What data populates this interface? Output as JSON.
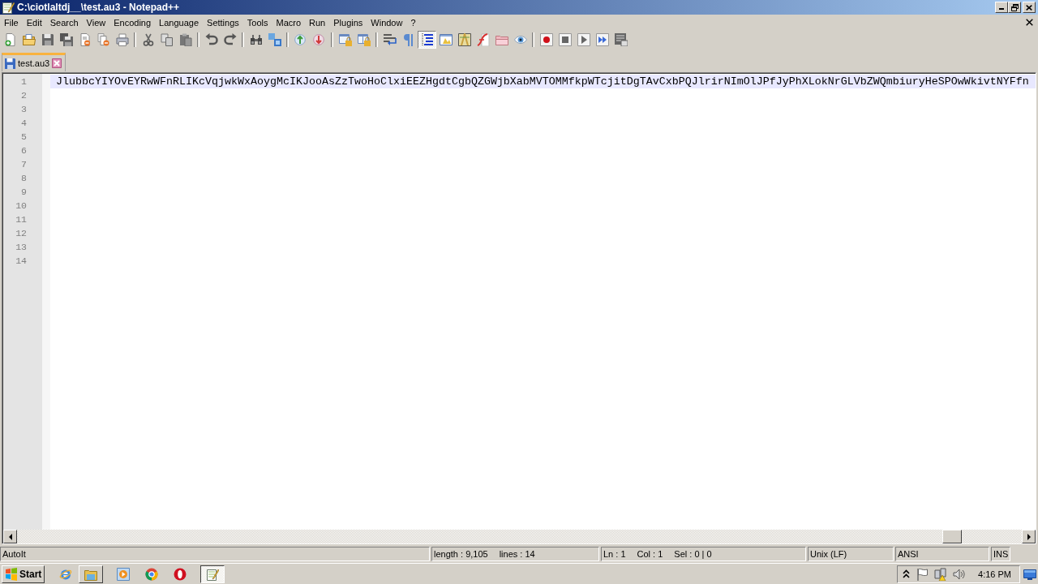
{
  "window": {
    "title": "C:\\ciotlaltdj__\\test.au3 - Notepad++"
  },
  "menu": [
    "File",
    "Edit",
    "Search",
    "View",
    "Encoding",
    "Language",
    "Settings",
    "Tools",
    "Macro",
    "Run",
    "Plugins",
    "Window",
    "?"
  ],
  "toolbar": [
    [
      {
        "kind": "new",
        "pressed": false
      },
      {
        "kind": "open",
        "pressed": false
      },
      {
        "kind": "save",
        "pressed": false
      },
      {
        "kind": "saveall",
        "pressed": false
      },
      {
        "kind": "close",
        "pressed": false
      },
      {
        "kind": "closeall",
        "pressed": false
      },
      {
        "kind": "print",
        "pressed": false
      }
    ],
    [
      {
        "kind": "cut",
        "pressed": false
      },
      {
        "kind": "copy",
        "pressed": false
      },
      {
        "kind": "paste",
        "pressed": false
      }
    ],
    [
      {
        "kind": "undo",
        "pressed": false
      },
      {
        "kind": "redo",
        "pressed": false
      }
    ],
    [
      {
        "kind": "find",
        "pressed": false
      },
      {
        "kind": "replace",
        "pressed": false
      }
    ],
    [
      {
        "kind": "zoomin",
        "pressed": false
      },
      {
        "kind": "zoomout",
        "pressed": false
      }
    ],
    [
      {
        "kind": "syncv",
        "pressed": false
      },
      {
        "kind": "synch",
        "pressed": false
      }
    ],
    [
      {
        "kind": "wrap",
        "pressed": false
      },
      {
        "kind": "symbols",
        "pressed": false
      },
      {
        "kind": "indent",
        "pressed": true
      },
      {
        "kind": "udl",
        "pressed": false
      },
      {
        "kind": "docmap",
        "pressed": false
      },
      {
        "kind": "funclist",
        "pressed": false
      },
      {
        "kind": "workspace",
        "pressed": false
      },
      {
        "kind": "monitor",
        "pressed": false
      }
    ],
    [
      {
        "kind": "record",
        "pressed": false
      },
      {
        "kind": "stop",
        "pressed": false
      },
      {
        "kind": "play",
        "pressed": false
      },
      {
        "kind": "playmulti",
        "pressed": false
      },
      {
        "kind": "savemacro",
        "pressed": false
      }
    ]
  ],
  "tabs": [
    {
      "label": "test.au3",
      "selected": true
    }
  ],
  "editor": {
    "lines": [
      {
        "number": "1",
        "text": "JlubbcYIYOvEYRwWFnRLIKcVqjwkWxAoygMcIKJooAsZzTwoHoClxiEEZHgdtCgbQZGWjbXabMVTOMMfkpWTcjitDgTAvCxbPQJlrirNImOlJPfJyPhXLokNrGLVbZWQmbiuryHeSPOwWkivtNYFfn",
        "current": true
      },
      {
        "number": "2",
        "current": false
      },
      {
        "number": "3",
        "current": false
      },
      {
        "number": "4",
        "current": false
      },
      {
        "number": "5",
        "current": false
      },
      {
        "number": "6",
        "current": false
      },
      {
        "number": "7",
        "current": false
      },
      {
        "number": "8",
        "current": false
      },
      {
        "number": "9",
        "current": false
      },
      {
        "number": "10",
        "current": false
      },
      {
        "number": "11",
        "current": false
      },
      {
        "number": "12",
        "current": false
      },
      {
        "number": "13",
        "current": false
      },
      {
        "number": "14",
        "current": false
      }
    ]
  },
  "status_bar": {
    "language": "AutoIt",
    "length": "length : 9,105",
    "lines": "lines : 14",
    "position": [
      "Ln : 1",
      "Col : 1",
      "Sel : 0 | 0"
    ],
    "eol": "Unix (LF)",
    "encoding": "ANSI",
    "mode": "INS"
  },
  "taskbar": {
    "start": "Start",
    "apps": [
      {
        "kind": "ie",
        "active": false
      },
      {
        "kind": "explorer",
        "active": false
      },
      {
        "kind": "media",
        "active": false
      },
      {
        "kind": "chrome",
        "active": false
      },
      {
        "kind": "opera",
        "active": false
      },
      {
        "kind": "notepad",
        "active": true
      }
    ],
    "clock": "4:16 PM"
  }
}
